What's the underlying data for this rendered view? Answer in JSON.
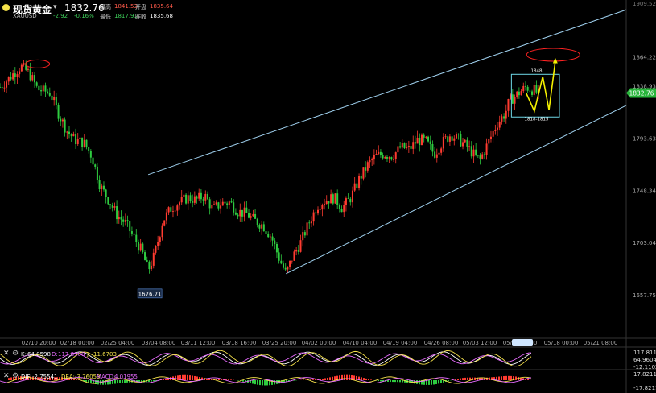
{
  "header": {
    "name": "现货黄金",
    "symbol": "XAUUSD",
    "last": "1832.76",
    "change": "-2.92",
    "change_pct": "-0.16%",
    "high_label": "最高",
    "high": "1841.53",
    "open_label": "开盘",
    "open": "1835.64",
    "low_label": "最低",
    "low": "1817.91",
    "prev_label": "昨收",
    "prev": "1835.68"
  },
  "colors": {
    "up": "#ff3b30",
    "down": "#2ecc40",
    "channel": "#9fd0ee",
    "price_line": "#2bbf3a",
    "highlight": "#ff2222",
    "forecast": "#f4f000"
  },
  "annotations": {
    "low_callout": "1676.71",
    "box_top": "1848",
    "box_bottom": "1818-1815",
    "current_price_tag": "1832.76",
    "top_right_axis": "1909.52"
  },
  "indicators": {
    "kdj": {
      "k_label": "K:",
      "k": "64.0598",
      "d_label": "D:",
      "d": "117.8108",
      "j_label": "J:",
      "j": "11.6703",
      "axis": [
        "117.811",
        "64.9604",
        "-12.1102"
      ]
    },
    "macd": {
      "dif_label": "DIF:",
      "dif": "-2.75541",
      "dea_label": "DEA:",
      "dea": "-3.76053",
      "macd_label": "MACD:",
      "macd": "4.01955",
      "axis": [
        "17.82117",
        "-17.82117"
      ]
    }
  },
  "chart_data": {
    "type": "candlestick",
    "title": "现货黄金 XAUUSD",
    "ylim": [
      1620,
      1910
    ],
    "y_ticks": [
      1864.22,
      1838.93,
      1793.63,
      1748.34,
      1703.04,
      1657.75
    ],
    "x_ticks": [
      "02/10 20:00",
      "02/18 00:00",
      "02/25 04:00",
      "03/04 08:00",
      "03/11 12:00",
      "03/18 16:00",
      "03/25 20:00",
      "04/02 00:00",
      "04/10 04:00",
      "04/19 04:00",
      "04/26 08:00",
      "05/03 12:00",
      "05/10 16:00",
      "05/18 00:00",
      "05/21 08:00"
    ],
    "price_path": [
      [
        0,
        1838
      ],
      [
        5,
        1847
      ],
      [
        10,
        1856
      ],
      [
        14,
        1850
      ],
      [
        18,
        1836
      ],
      [
        24,
        1833
      ],
      [
        28,
        1815
      ],
      [
        32,
        1800
      ],
      [
        36,
        1792
      ],
      [
        40,
        1790
      ],
      [
        44,
        1778
      ],
      [
        48,
        1752
      ],
      [
        52,
        1740
      ],
      [
        56,
        1727
      ],
      [
        60,
        1720
      ],
      [
        64,
        1708
      ],
      [
        68,
        1695
      ],
      [
        71,
        1679
      ],
      [
        74,
        1692
      ],
      [
        78,
        1722
      ],
      [
        82,
        1733
      ],
      [
        86,
        1738
      ],
      [
        90,
        1742
      ],
      [
        94,
        1740
      ],
      [
        98,
        1744
      ],
      [
        102,
        1732
      ],
      [
        106,
        1737
      ],
      [
        110,
        1738
      ],
      [
        114,
        1730
      ],
      [
        118,
        1728
      ],
      [
        122,
        1722
      ],
      [
        126,
        1718
      ],
      [
        130,
        1708
      ],
      [
        134,
        1688
      ],
      [
        137,
        1676
      ],
      [
        140,
        1690
      ],
      [
        144,
        1703
      ],
      [
        148,
        1720
      ],
      [
        152,
        1735
      ],
      [
        156,
        1740
      ],
      [
        160,
        1742
      ],
      [
        164,
        1733
      ],
      [
        168,
        1742
      ],
      [
        172,
        1758
      ],
      [
        176,
        1770
      ],
      [
        180,
        1778
      ],
      [
        184,
        1780
      ],
      [
        188,
        1778
      ],
      [
        192,
        1786
      ],
      [
        196,
        1784
      ],
      [
        200,
        1792
      ],
      [
        204,
        1791
      ],
      [
        208,
        1780
      ],
      [
        212,
        1790
      ],
      [
        216,
        1797
      ],
      [
        220,
        1792
      ],
      [
        224,
        1786
      ],
      [
        228,
        1777
      ],
      [
        230,
        1775
      ],
      [
        234,
        1790
      ],
      [
        238,
        1806
      ],
      [
        242,
        1815
      ],
      [
        244,
        1826
      ],
      [
        248,
        1832
      ],
      [
        252,
        1838
      ],
      [
        256,
        1835
      ],
      [
        258,
        1832
      ]
    ],
    "current_price": 1832.76,
    "channel": {
      "upper": [
        [
          71,
          1762
        ],
        [
          300,
          1905
        ]
      ],
      "lower": [
        [
          137,
          1676
        ],
        [
          300,
          1822
        ]
      ]
    },
    "forecast_path": [
      [
        252,
        1833
      ],
      [
        256,
        1817
      ],
      [
        260,
        1847
      ],
      [
        263,
        1818
      ],
      [
        266,
        1860
      ]
    ],
    "forecast_box": {
      "x0": 245,
      "x1": 268,
      "y0": 1812,
      "y1": 1849
    },
    "highlights": [
      {
        "x": 18,
        "y": 1858
      },
      {
        "x": 265,
        "y": 1866
      }
    ]
  }
}
